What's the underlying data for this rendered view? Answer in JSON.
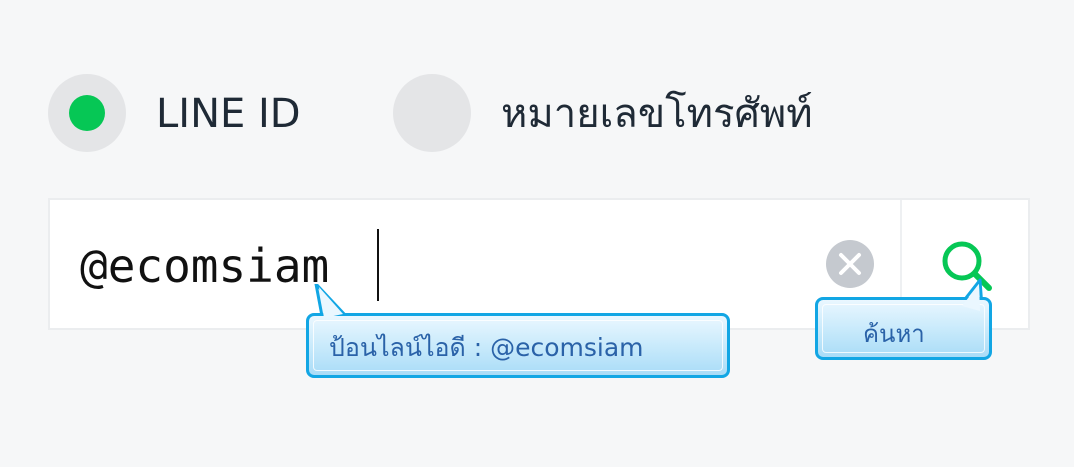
{
  "radio_options": [
    {
      "label": "LINE ID",
      "selected": true
    },
    {
      "label": "หมายเลขโทรศัพท์",
      "selected": false
    }
  ],
  "search": {
    "value": "@ecomsiam"
  },
  "tooltips": {
    "input_hint": "ป้อนไลน์ไอดี : @ecomsiam",
    "search_hint": "ค้นหา"
  },
  "colors": {
    "accent_green": "#06c755",
    "tooltip_border": "#12a6e4",
    "tooltip_text": "#2a62a8"
  },
  "icons": {
    "clear": "clear-icon",
    "search": "search-icon"
  }
}
